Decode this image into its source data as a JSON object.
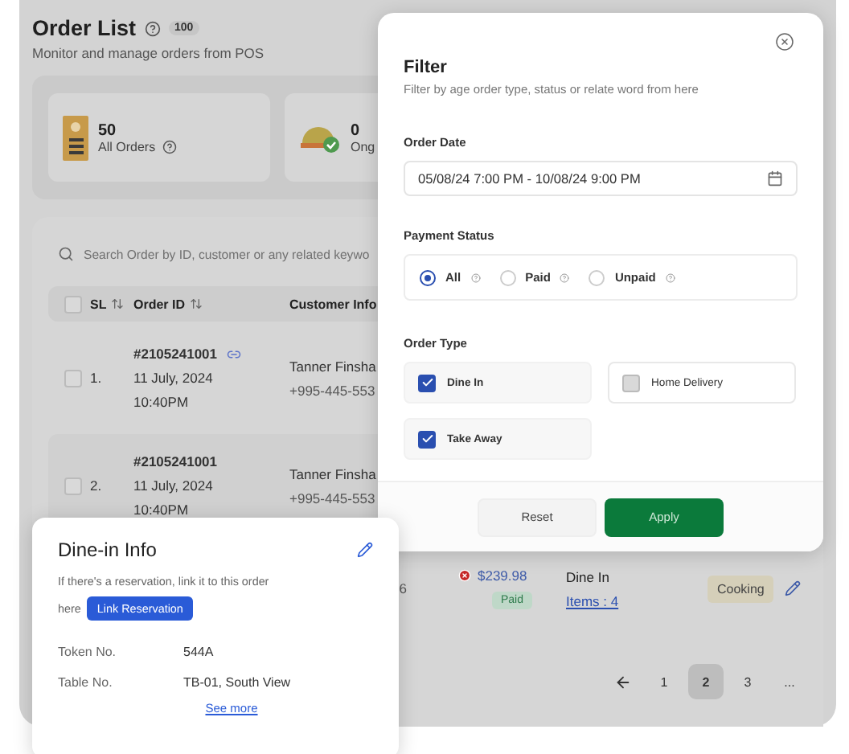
{
  "page": {
    "title": "Order List",
    "count": "100",
    "subtitle": "Monitor and manage orders from POS"
  },
  "stats": [
    {
      "kind": "all",
      "value": "50",
      "label": "All Orders",
      "help": true
    },
    {
      "kind": "ongoing",
      "value": "0",
      "label": "Ong"
    }
  ],
  "search": {
    "placeholder": "Search Order by ID, customer or any related keywo"
  },
  "table": {
    "select_all_checked": false,
    "columns": [
      {
        "label": "SL",
        "sortable": true
      },
      {
        "label": "Order ID",
        "sortable": true
      },
      {
        "label": "Customer Info"
      }
    ],
    "rows": [
      {
        "checked": false,
        "sl": "1.",
        "order_id": "#2105241001",
        "linked": true,
        "date": "11 July, 2024",
        "time": "10:40PM",
        "customer": "Tanner Finsha",
        "phone": "+995-445-553"
      },
      {
        "checked": false,
        "sl": "2.",
        "order_id": "#2105241001",
        "linked": false,
        "date": "11 July, 2024",
        "time": "10:40PM",
        "customer": "Tanner Finsha",
        "phone": "+995-445-553"
      },
      {
        "phone": "6",
        "amount": "$239.98",
        "payment": "Paid",
        "order_type": "Dine In",
        "items": "Items : 4",
        "status": "Cooking"
      }
    ]
  },
  "pagination": {
    "pages": [
      {
        "label": "1",
        "selected": false
      },
      {
        "label": "2",
        "selected": true
      },
      {
        "label": "3",
        "selected": false
      }
    ],
    "more": "..."
  },
  "filter": {
    "title": "Filter",
    "subtitle": "Filter by age order type, status or relate word from here",
    "order_date": {
      "label": "Order Date",
      "value": "05/08/24 7:00 PM - 10/08/24 9:00 PM"
    },
    "payment_status": {
      "label": "Payment Status",
      "options": [
        {
          "label": "All",
          "selected": true
        },
        {
          "label": "Paid",
          "selected": false
        },
        {
          "label": "Unpaid",
          "selected": false
        }
      ]
    },
    "order_type": {
      "label": "Order Type",
      "options": [
        {
          "label": "Dine In",
          "checked": true
        },
        {
          "label": "Home Delivery",
          "checked": false
        },
        {
          "label": "Take Away",
          "checked": true
        }
      ]
    },
    "buttons": [
      {
        "kind": "secondary",
        "label": "Reset"
      },
      {
        "kind": "primary",
        "label": "Apply"
      }
    ]
  },
  "dine_in": {
    "title": "Dine-in Info",
    "hint": "If there's a reservation, link it to this order here",
    "button": "Link Reservation",
    "fields": [
      {
        "label": "Token No.",
        "value": "544A"
      },
      {
        "label": "Table No.",
        "value": "TB-01, South View"
      }
    ],
    "link": "See more"
  }
}
